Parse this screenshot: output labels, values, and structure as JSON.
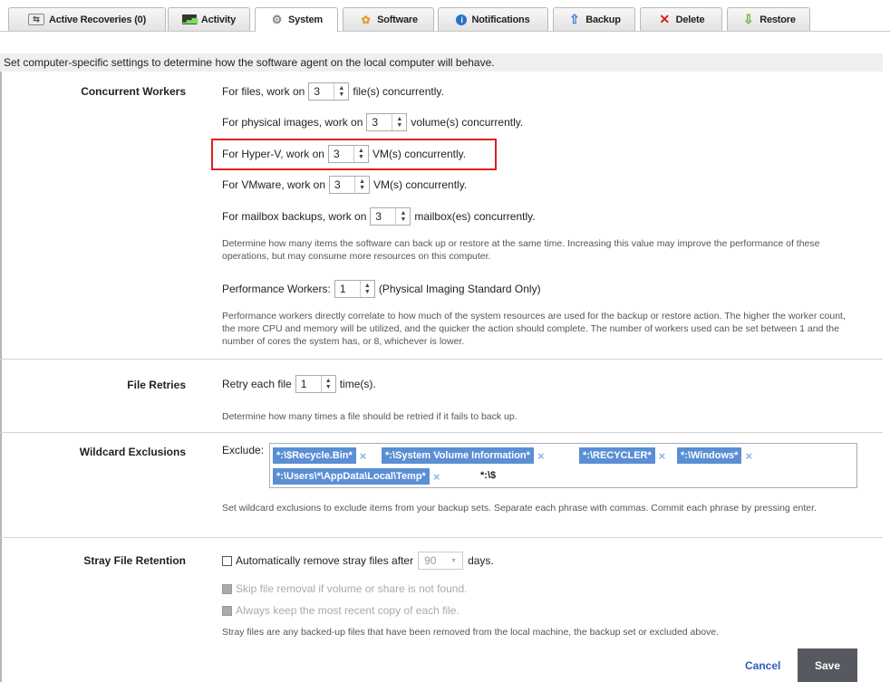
{
  "tabs": [
    {
      "label": "Active Recoveries (0)",
      "icon": "recoveries-icon"
    },
    {
      "label": "Activity",
      "icon": "activity-icon"
    },
    {
      "label": "System",
      "icon": "gear-icon",
      "active": true
    },
    {
      "label": "Software",
      "icon": "software-icon"
    },
    {
      "label": "Notifications",
      "icon": "info-icon"
    },
    {
      "label": "Backup",
      "icon": "up-arrow-icon"
    },
    {
      "label": "Delete",
      "icon": "delete-x-icon"
    },
    {
      "label": "Restore",
      "icon": "down-arrow-icon"
    }
  ],
  "intro": "Set computer-specific settings to determine how the software agent on the local computer will behave.",
  "concurrent": {
    "label": "Concurrent Workers",
    "files": {
      "pre": "For files, work on",
      "value": "3",
      "post": "file(s) concurrently."
    },
    "physical": {
      "pre": "For physical images, work on",
      "value": "3",
      "post": "volume(s) concurrently."
    },
    "hyperv": {
      "pre": "For Hyper-V, work on",
      "value": "3",
      "post": "VM(s) concurrently."
    },
    "vmware": {
      "pre": "For VMware, work on",
      "value": "3",
      "post": "VM(s) concurrently."
    },
    "mailbox": {
      "pre": "For mailbox backups, work on",
      "value": "3",
      "post": "mailbox(es) concurrently."
    },
    "help": "Determine how many items the software can back up or restore at the same time. Increasing this value may improve the performance of these operations, but may consume more resources on this computer.",
    "perf": {
      "pre": "Performance Workers:",
      "value": "1",
      "post": "(Physical Imaging Standard Only)"
    },
    "perf_help": "Performance workers directly correlate to how much of the system resources are used for the backup or restore action. The higher the worker count, the more CPU and memory will be utilized, and the quicker the action should complete. The number of workers used can be set between 1 and the number of cores the system has, or 8, whichever is lower."
  },
  "retries": {
    "label": "File Retries",
    "pre": "Retry each file",
    "value": "1",
    "post": "time(s).",
    "help": "Determine how many times a file should be retried if it fails to back up."
  },
  "wildcard": {
    "label": "Wildcard Exclusions",
    "exclude_label": "Exclude:",
    "chips": [
      "*:\\$Recycle.Bin*",
      "*:\\System Volume Information*",
      "*:\\RECYCLER*",
      "*:\\Windows*",
      "*:\\Users\\*\\AppData\\Local\\Temp*"
    ],
    "typed": "*:\\$",
    "remove_glyph": "×",
    "help": "Set wildcard exclusions to exclude items from your backup sets. Separate each phrase with commas. Commit each phrase by pressing enter."
  },
  "stray": {
    "label": "Stray File Retention",
    "auto_pre": "Automatically remove stray files after",
    "days_value": "90",
    "auto_post": "days.",
    "skip": "Skip file removal if volume or share is not found.",
    "keep": "Always keep the most recent copy of each file.",
    "help": "Stray files are any backed-up files that have been removed from the local machine, the backup set or excluded above."
  },
  "buttons": {
    "cancel": "Cancel",
    "save": "Save"
  }
}
